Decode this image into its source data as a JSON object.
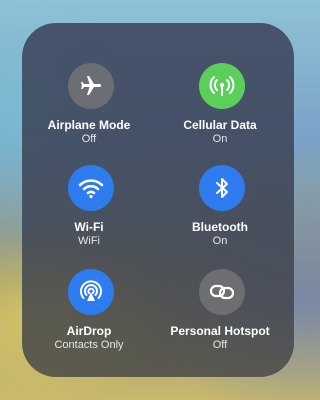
{
  "tiles": [
    {
      "label": "Airplane Mode",
      "status": "Off",
      "icon": "airplane-icon",
      "color": "#787878"
    },
    {
      "label": "Cellular Data",
      "status": "On",
      "icon": "antenna-icon",
      "color": "#5ccf5a"
    },
    {
      "label": "Wi-Fi",
      "status": "WiFi",
      "icon": "wifi-icon",
      "color": "#2f7bf0"
    },
    {
      "label": "Bluetooth",
      "status": "On",
      "icon": "bluetooth-icon",
      "color": "#2f7bf0"
    },
    {
      "label": "AirDrop",
      "status": "Contacts Only",
      "icon": "airdrop-icon",
      "color": "#2f7bf0"
    },
    {
      "label": "Personal Hotspot",
      "status": "Off",
      "icon": "hotspot-chain-icon",
      "color": "#787878"
    }
  ]
}
